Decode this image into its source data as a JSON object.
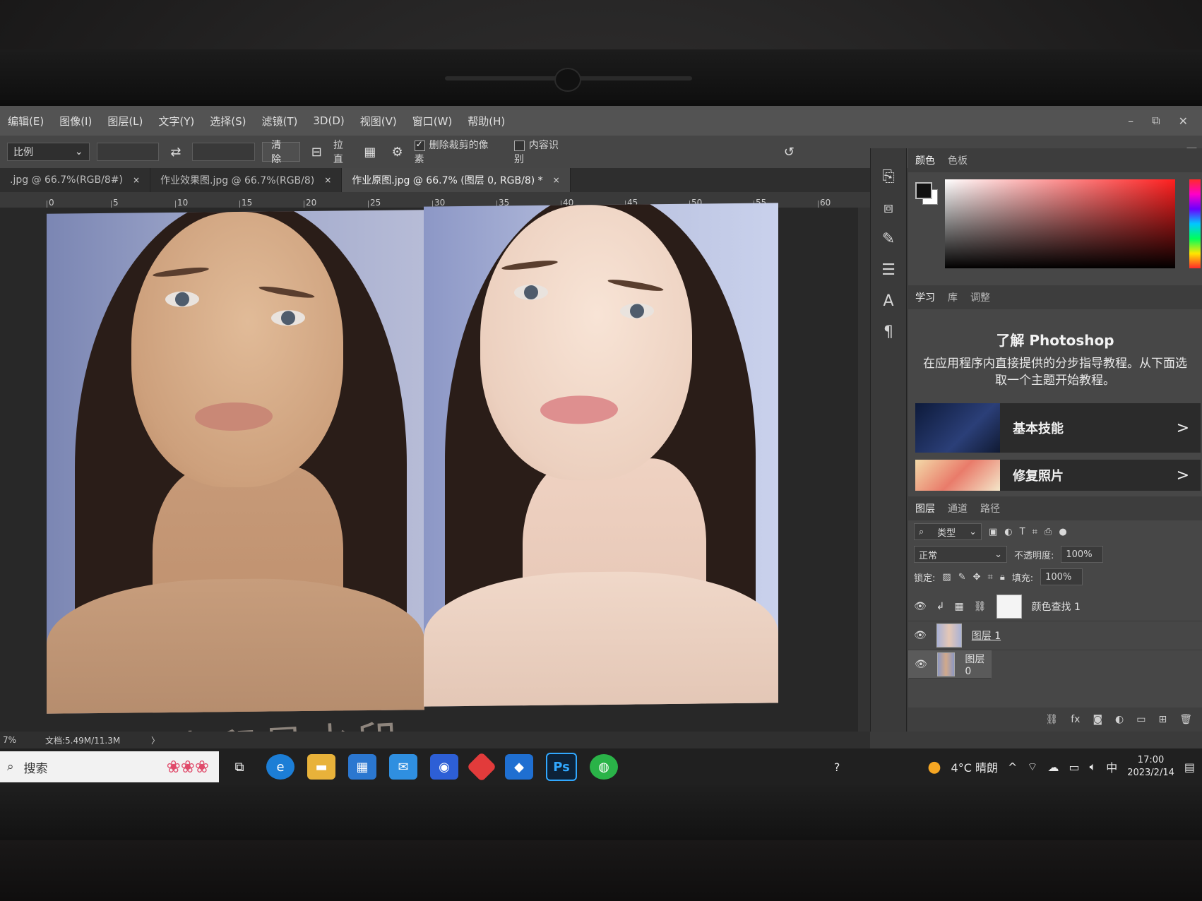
{
  "menu": [
    "编辑(E)",
    "图像(I)",
    "图层(L)",
    "文字(Y)",
    "选择(S)",
    "滤镜(T)",
    "3D(D)",
    "视图(V)",
    "窗口(W)",
    "帮助(H)"
  ],
  "window_controls": {
    "minimize": "–",
    "restore": "⧉",
    "close": "✕"
  },
  "options": {
    "ratio_select": "比例",
    "clear_button": "清除",
    "straighten_label": "拉直",
    "delete_cropped_label": "删除裁剪的像素",
    "content_aware_label": "内容识别"
  },
  "tabs": [
    {
      "label": ".jpg @ 66.7%(RGB/8#)",
      "close": "×"
    },
    {
      "label": "作业效果图.jpg @ 66.7%(RGB/8)",
      "close": "×"
    },
    {
      "label": "作业原图.jpg @ 66.7% (图层 0, RGB/8) *",
      "close": "×"
    }
  ],
  "ruler_ticks": [
    "0",
    "5",
    "10",
    "15",
    "20",
    "25",
    "30",
    "35",
    "40",
    "45",
    "50",
    "55",
    "60"
  ],
  "watermark_text": "我是水印是水印",
  "status": {
    "zoom": "7%",
    "doc": "文档:5.49M/11.3M",
    "arrow": "〉"
  },
  "color_panel": {
    "tabs": [
      "颜色",
      "色板"
    ]
  },
  "learn_panel": {
    "tabs": [
      "学习",
      "库",
      "调整"
    ],
    "title": "了解 Photoshop",
    "description": "在应用程序内直接提供的分步指导教程。从下面选取一个主题开始教程。",
    "cards": [
      {
        "label": "基本技能",
        "chevron": ">"
      },
      {
        "label": "修复照片",
        "chevron": ">"
      }
    ]
  },
  "layers_panel": {
    "tabs": [
      "图层",
      "通道",
      "路径"
    ],
    "filter_select": "类型",
    "blend_mode": "正常",
    "opacity_label": "不透明度:",
    "opacity_value": "100%",
    "lock_label": "锁定:",
    "fill_label": "填充:",
    "fill_value": "100%",
    "layers": [
      {
        "name": "颜色查找 1",
        "selected": false
      },
      {
        "name": "图层 1",
        "selected": false
      },
      {
        "name": "图层 0",
        "selected": true
      }
    ]
  },
  "taskbar": {
    "search_placeholder": "搜索",
    "weather": "4°C 晴朗",
    "ime": "中",
    "time": "17:00",
    "date": "2023/2/14",
    "ps_label": "Ps"
  }
}
